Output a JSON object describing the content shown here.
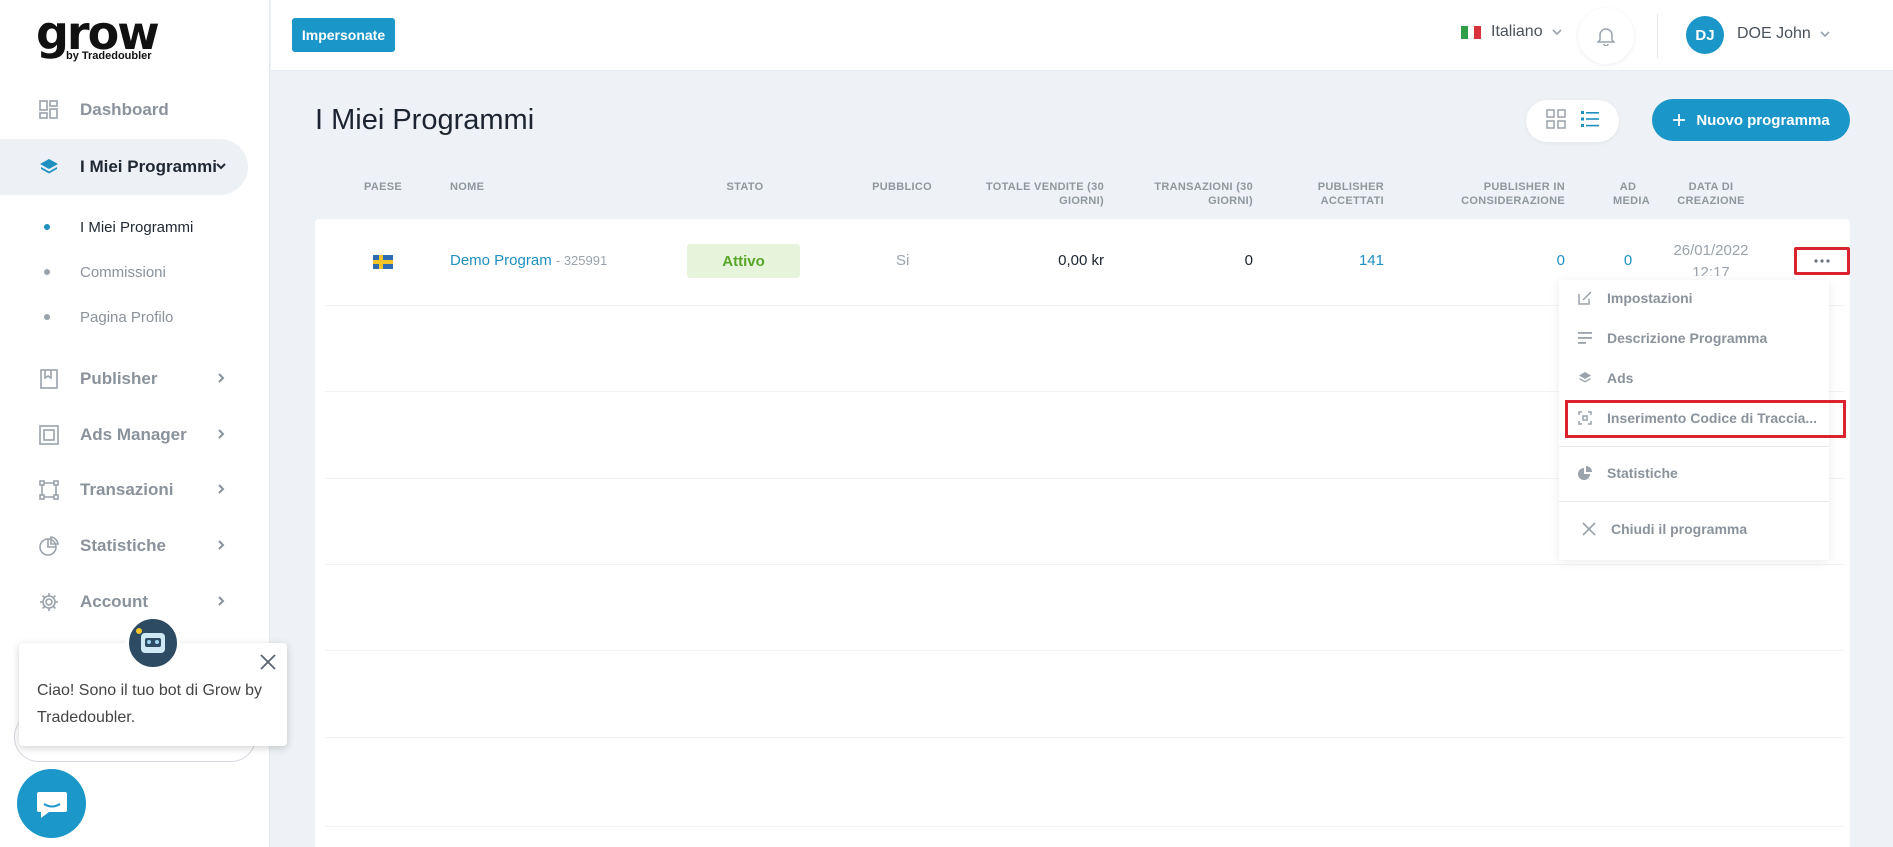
{
  "brand": {
    "logo_word": "grow",
    "logo_sub": "by Tradedoubler"
  },
  "sidebar": {
    "items": [
      {
        "label": "Dashboard",
        "icon": "dashboard-icon"
      },
      {
        "label": "I Miei Programmi",
        "icon": "layers-icon",
        "expanded": true
      },
      {
        "label": "Publisher",
        "icon": "book-icon"
      },
      {
        "label": "Ads Manager",
        "icon": "frame-icon"
      },
      {
        "label": "Transazioni",
        "icon": "nodes-icon"
      },
      {
        "label": "Statistiche",
        "icon": "pie-icon"
      },
      {
        "label": "Account",
        "icon": "gear-icon"
      }
    ],
    "subitems": [
      {
        "label": "I Miei Programmi",
        "active": true
      },
      {
        "label": "Commissioni",
        "active": false
      },
      {
        "label": "Pagina Profilo",
        "active": false
      }
    ]
  },
  "chatbot": {
    "message": "Ciao! Sono il tuo bot di Grow by Tradedoubler."
  },
  "topbar": {
    "impersonate_label": "Impersonate",
    "language": "Italiano",
    "user_initials": "DJ",
    "user_name": "DOE John"
  },
  "main": {
    "title": "I Miei Programmi",
    "new_program_label": "Nuovo programma",
    "columns": {
      "paese": "PAESE",
      "nome": "NOME",
      "stato": "STATO",
      "pubblico": "PUBBLICO",
      "totale_vendite": "TOTALE VENDITE (30 GIORNI)",
      "transazioni": "TRANSAZIONI (30 GIORNI)",
      "publisher_accettati": "PUBLISHER ACCETTATI",
      "publisher_considerazione": "PUBLISHER IN CONSIDERAZIONE",
      "ad_media": "AD MEDIA",
      "data_creazione": "DATA DI CREAZIONE"
    },
    "rows": [
      {
        "country": "SE",
        "name": "Demo Program",
        "id": "- 325991",
        "status": "Attivo",
        "public": "Si",
        "total_sales": "0,00 kr",
        "transactions": "0",
        "accepted_publishers": "141",
        "pending_publishers": "0",
        "ad_media": "0",
        "created": "26/01/2022",
        "created_time": "12:17"
      }
    ]
  },
  "menu": {
    "items": [
      {
        "label": "Impostazioni",
        "icon": "edit-icon"
      },
      {
        "label": "Descrizione Programma",
        "icon": "text-lines-icon"
      },
      {
        "label": "Ads",
        "icon": "layers-icon"
      },
      {
        "label": "Inserimento Codice di Traccia...",
        "icon": "scan-icon"
      },
      {
        "label": "Statistiche",
        "icon": "pie-icon"
      },
      {
        "label": "Chiudi il programma",
        "icon": "close-icon"
      }
    ]
  },
  "colors": {
    "accent": "#1a96c8",
    "status_green": "#58a52a",
    "highlight_red": "#d9232d"
  }
}
